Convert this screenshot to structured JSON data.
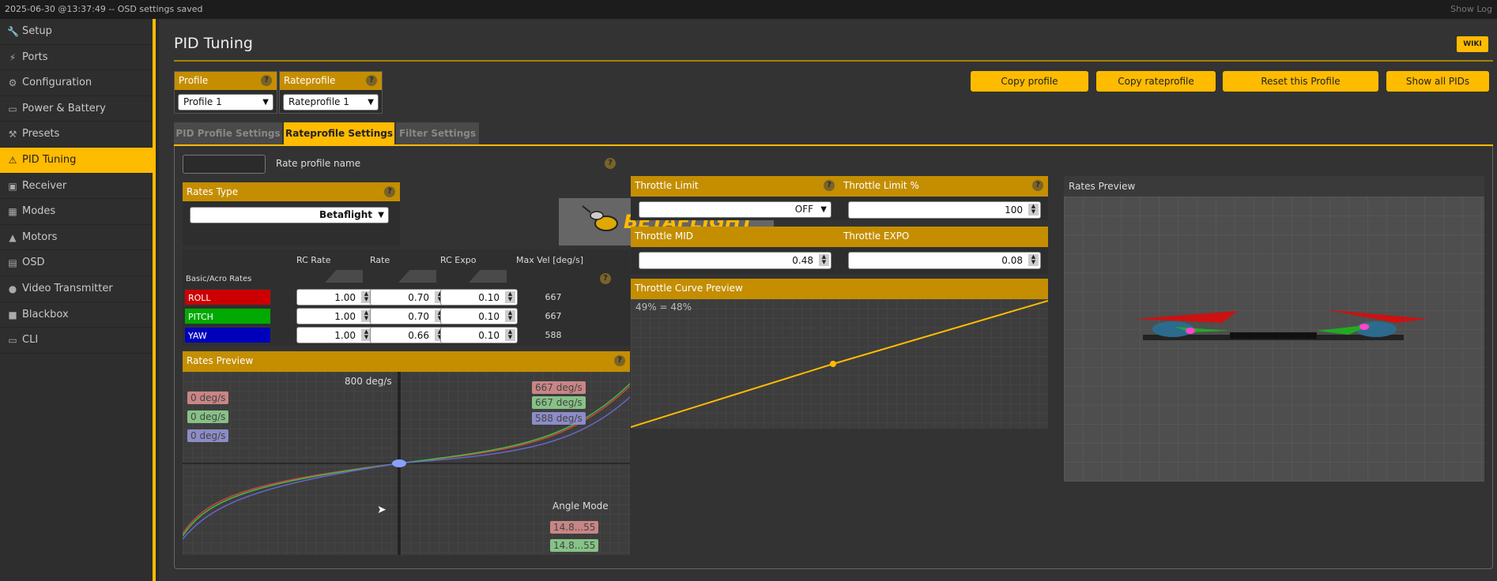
{
  "status": {
    "log": "2025-06-30 @13:37:49 -- OSD settings saved",
    "show_log": "Show Log"
  },
  "sidebar": {
    "items": [
      {
        "label": "Setup",
        "icon": "wrench-icon"
      },
      {
        "label": "Ports",
        "icon": "plug-icon"
      },
      {
        "label": "Configuration",
        "icon": "gear-icon"
      },
      {
        "label": "Power & Battery",
        "icon": "battery-icon"
      },
      {
        "label": "Presets",
        "icon": "tools-icon"
      },
      {
        "label": "PID Tuning",
        "icon": "warning-icon"
      },
      {
        "label": "Receiver",
        "icon": "receiver-icon"
      },
      {
        "label": "Modes",
        "icon": "modes-icon"
      },
      {
        "label": "Motors",
        "icon": "motor-icon"
      },
      {
        "label": "OSD",
        "icon": "osd-icon"
      },
      {
        "label": "Video Transmitter",
        "icon": "antenna-icon"
      },
      {
        "label": "Blackbox",
        "icon": "blackbox-icon"
      },
      {
        "label": "CLI",
        "icon": "terminal-icon"
      }
    ],
    "active_index": 5
  },
  "page": {
    "title": "PID Tuning",
    "wiki": "WIKI"
  },
  "profile": {
    "label": "Profile",
    "value": "Profile 1"
  },
  "rateprofile": {
    "label": "Rateprofile",
    "value": "Rateprofile 1"
  },
  "buttons": {
    "copy_profile": "Copy profile",
    "copy_rateprofile": "Copy rateprofile",
    "reset": "Reset this Profile",
    "show_all": "Show all PIDs"
  },
  "tabs": [
    "PID Profile Settings",
    "Rateprofile Settings",
    "Filter Settings"
  ],
  "active_tab": 1,
  "rate_profile_name": {
    "label": "Rate profile name",
    "value": ""
  },
  "rates_type": {
    "label": "Rates Type",
    "value": "Betaflight"
  },
  "logo_text": "BETAFLIGHT",
  "rates_table": {
    "group_label": "Basic/Acro Rates",
    "headers": [
      "RC Rate",
      "Rate",
      "RC Expo",
      "Max Vel [deg/s]"
    ],
    "rows": [
      {
        "axis": "ROLL",
        "color": "#cc0000",
        "rc_rate": "1.00",
        "rate": "0.70",
        "rc_expo": "0.10",
        "max_vel": "667"
      },
      {
        "axis": "PITCH",
        "color": "#00aa00",
        "rc_rate": "1.00",
        "rate": "0.70",
        "rc_expo": "0.10",
        "max_vel": "667"
      },
      {
        "axis": "YAW",
        "color": "#0000bb",
        "rc_rate": "1.00",
        "rate": "0.66",
        "rc_expo": "0.10",
        "max_vel": "588"
      }
    ]
  },
  "rates_preview": {
    "title": "Rates Preview",
    "center_label": "800 deg/s",
    "left_labels": [
      "0 deg/s",
      "0 deg/s",
      "0 deg/s"
    ],
    "right_labels": [
      "667 deg/s",
      "667 deg/s",
      "588 deg/s"
    ],
    "angle_mode_label": "Angle Mode",
    "angle_values": [
      "14.8...55",
      "14.8...55"
    ]
  },
  "throttle": {
    "limit_label": "Throttle Limit",
    "limit_value": "OFF",
    "limit_pct_label": "Throttle Limit %",
    "limit_pct_value": "100",
    "mid_label": "Throttle MID",
    "mid_value": "0.48",
    "expo_label": "Throttle EXPO",
    "expo_value": "0.08",
    "curve_title": "Throttle Curve Preview",
    "curve_readout": "49% = 48%"
  },
  "rates_preview_3d": {
    "title": "Rates Preview"
  },
  "colors": {
    "accent": "#ffbb00",
    "header": "#c48e00"
  }
}
